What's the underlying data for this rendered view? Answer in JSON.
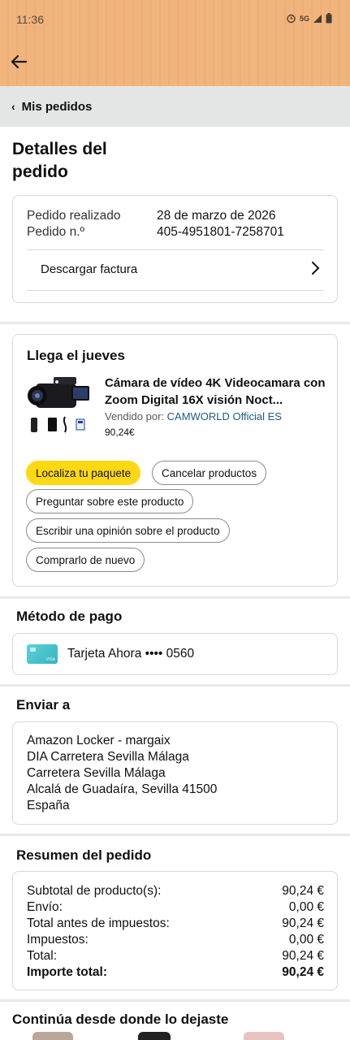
{
  "status_bar": {
    "time": "11:36",
    "network": "5G"
  },
  "header": {
    "breadcrumb": "Mis pedidos",
    "title": "Detalles del pedido"
  },
  "order_info": {
    "placed_label": "Pedido realizado",
    "placed_value": "28 de marzo de 2026",
    "number_label": "Pedido n.º",
    "number_value": "405-4951801-7258701",
    "invoice_label": "Descargar factura"
  },
  "delivery": {
    "heading": "Llega el jueves",
    "product_title": "Cámara de vídeo 4K Videocamara con Zoom Digital 16X visión Noct...",
    "seller_prefix": "Vendido por:",
    "seller_name": "CAMWORLD Official ES",
    "price": "90,24€",
    "actions": {
      "track": "Localiza tu paquete",
      "cancel": "Cancelar productos",
      "ask": "Preguntar sobre este producto",
      "review": "Escribir una opinión sobre el producto",
      "rebuy": "Comprarlo de nuevo"
    }
  },
  "payment": {
    "heading": "Método de pago",
    "card_text": "Tarjeta Ahora •••• 0560"
  },
  "shipping": {
    "heading": "Enviar a",
    "lines": [
      "Amazon Locker - margaix",
      "DIA Carretera Sevilla Málaga",
      "Carretera Sevilla Málaga",
      "Alcalá de Guadaíra, Sevilla 41500",
      "España"
    ]
  },
  "summary": {
    "heading": "Resumen del pedido",
    "rows": [
      {
        "label": "Subtotal de producto(s):",
        "value": "90,24 €"
      },
      {
        "label": "Envío:",
        "value": "0,00 €"
      },
      {
        "label": "Total antes de impuestos:",
        "value": "90,24 €"
      },
      {
        "label": "Impuestos:",
        "value": "0,00 €"
      },
      {
        "label": "Total:",
        "value": "90,24 €"
      },
      {
        "label": "Importe total:",
        "value": "90,24 €"
      }
    ]
  },
  "continue_heading": "Continúa desde donde lo dejaste",
  "colors": {
    "header_bg": "#f0b47c",
    "primary_button": "#ffd814",
    "link": "#1a5c8a"
  }
}
